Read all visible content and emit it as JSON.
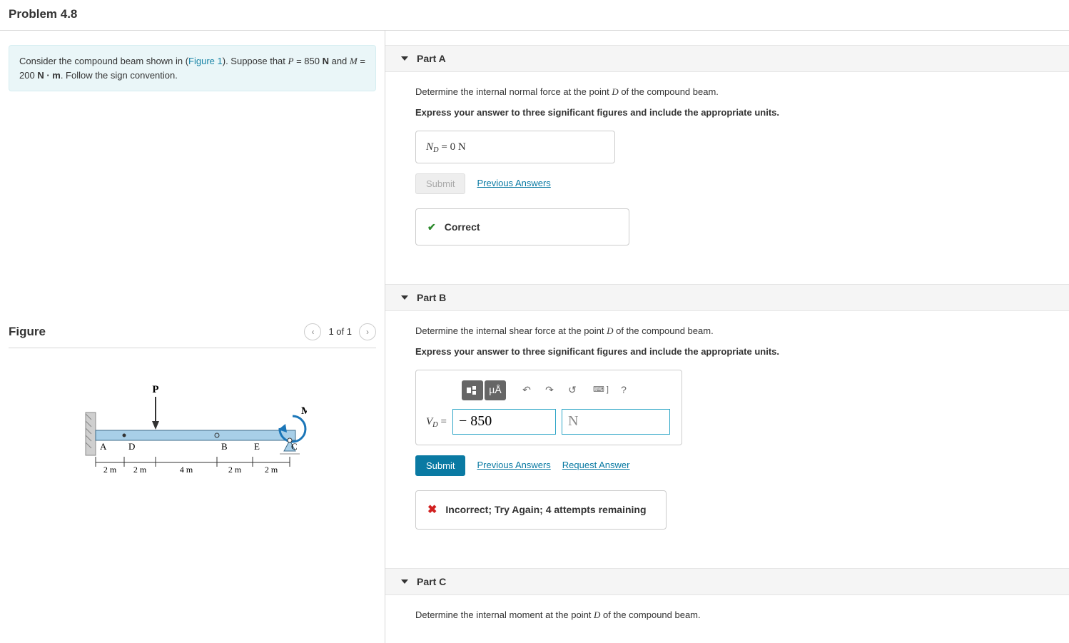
{
  "title": "Problem 4.8",
  "intro": {
    "text_before_link": "Consider the compound beam shown in (",
    "figure_link": "Figure 1",
    "text_after_link": "). Suppose that ",
    "P_var": "P",
    "P_eq": " = 850 ",
    "P_unit": "N",
    "and_word": " and ",
    "M_var": "M",
    "M_eq": " = 200 ",
    "M_unit": "N · m",
    "tail": ". Follow the sign convention."
  },
  "figure": {
    "heading": "Figure",
    "pager": "1 of 1",
    "labels": {
      "P": "P",
      "M": "M",
      "A": "A",
      "D": "D",
      "B": "B",
      "E": "E",
      "C": "C",
      "seg1": "2 m",
      "seg2": "2 m",
      "seg3": "4 m",
      "seg4": "2 m",
      "seg5": "2 m"
    }
  },
  "partA": {
    "title": "Part A",
    "prompt_before": "Determine the internal normal force at the point ",
    "point": "D",
    "prompt_after": " of the compound beam.",
    "directive": "Express your answer to three significant figures and include the appropriate units.",
    "answer_label": "N",
    "answer_sub": "D",
    "answer_eq": " =  0 N",
    "submit": "Submit",
    "prev": "Previous Answers",
    "feedback": "Correct"
  },
  "partB": {
    "title": "Part B",
    "prompt_before": "Determine the internal shear force at the point ",
    "point": "D",
    "prompt_after": " of the compound beam.",
    "directive": "Express your answer to three significant figures and include the appropriate units.",
    "eq_label": "V",
    "eq_sub": "D",
    "eq_after": " = ",
    "value": "− 850",
    "unit_placeholder": "N",
    "submit": "Submit",
    "prev": "Previous Answers",
    "req": "Request Answer",
    "feedback": "Incorrect; Try Again; 4 attempts remaining",
    "tool_units_label": "µÅ",
    "tool_help": "?"
  },
  "partC": {
    "title": "Part C",
    "prompt_before": "Determine the internal moment at the point ",
    "point": "D",
    "prompt_after": " of the compound beam."
  }
}
